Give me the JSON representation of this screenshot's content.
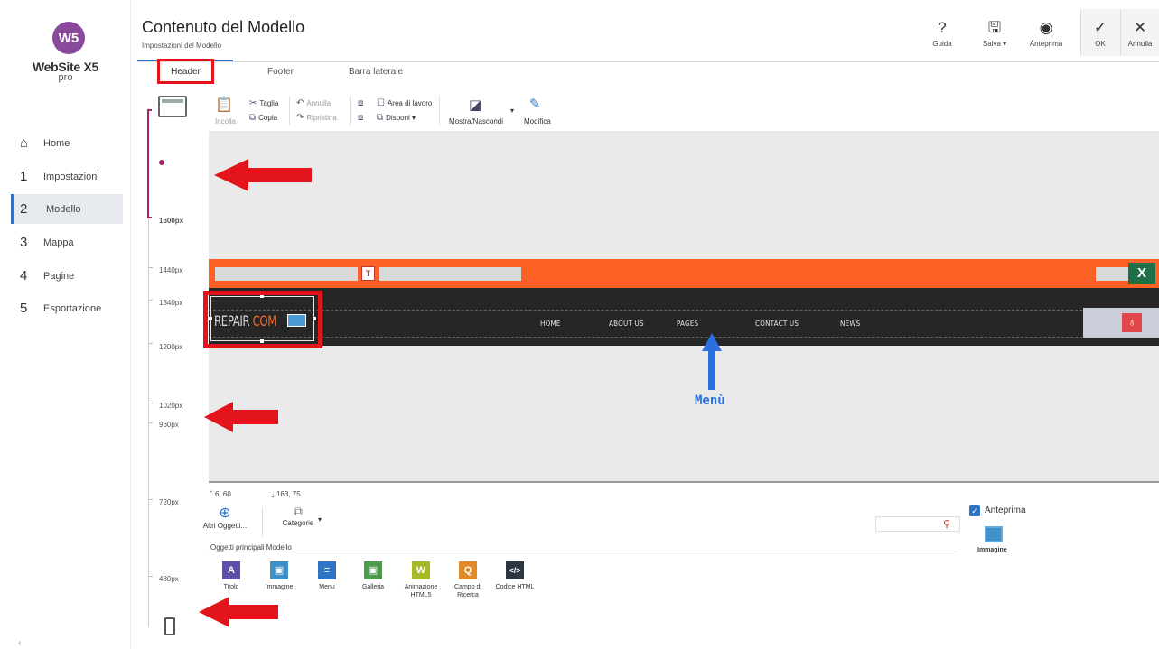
{
  "sidebar": {
    "logo_badge": "W5",
    "logo_name": "WebSite X5",
    "logo_sub": "pro",
    "items": [
      {
        "num": "",
        "label": "Home"
      },
      {
        "num": "1",
        "label": "Impostazioni"
      },
      {
        "num": "2",
        "label": "Modello"
      },
      {
        "num": "3",
        "label": "Mappa"
      },
      {
        "num": "4",
        "label": "Pagine"
      },
      {
        "num": "5",
        "label": "Esportazione"
      }
    ],
    "active_index": 2,
    "collapse": "‹"
  },
  "header": {
    "title": "Contenuto del Modello",
    "subtitle": "Impostazioni del Modello"
  },
  "top_toolbar": {
    "guida": "Guida",
    "salva": "Salva ▾",
    "anteprima": "Anteprima",
    "ok": "OK",
    "annulla": "Annulla"
  },
  "tabs": [
    "Header",
    "Footer",
    "Barra laterale"
  ],
  "ruler": {
    "labels": [
      "1600px",
      "1440px",
      "1340px",
      "1200px",
      "1020px",
      "960px",
      "720px",
      "480px"
    ]
  },
  "edit_toolbar": {
    "incolla": "Incolla",
    "taglia": "Taglia",
    "copia": "Copia",
    "annulla": "Annulla",
    "ripristina": "Ripristina",
    "area_lavoro": "Area di lavoro",
    "disponi": "Disponi ▾",
    "mostra": "Mostra/Nascondi",
    "modifica": "Modifica"
  },
  "canvas": {
    "logo_text": "REPAIR ",
    "logo_accent": "COM",
    "menu": [
      "HOME",
      "ABOUT US",
      "PAGES",
      "CONTACT US",
      "NEWS"
    ],
    "annotation": "Menù"
  },
  "bottom": {
    "pos": "6, 60",
    "size": "163, 75",
    "altri": "Altri Oggetti...",
    "categorie": "Categorie",
    "objs_title": "Oggetti principali Modello",
    "objects": [
      {
        "label": "Titolo",
        "color": "#5b4fa8",
        "glyph": "A"
      },
      {
        "label": "Immagine",
        "color": "#3f8fc9",
        "glyph": "▣"
      },
      {
        "label": "Menu",
        "color": "#2f73c4",
        "glyph": "≡"
      },
      {
        "label": "Galleria",
        "color": "#4e9a4b",
        "glyph": "▣"
      },
      {
        "label": "Animazione HTML5",
        "color": "#a7b927",
        "glyph": "W"
      },
      {
        "label": "Campo di Ricerca",
        "color": "#e08a28",
        "glyph": "Q"
      },
      {
        "label": "Codice HTML",
        "color": "#2c3540",
        "glyph": "</>"
      }
    ],
    "anteprima": "Anteprima",
    "immagine": "Immagine"
  },
  "colors": {
    "accent": "#2f73c4",
    "orange_bar": "#fc6226",
    "dark_bar": "#262626",
    "annotation_red": "#e3141b",
    "annotation_blue": "#2c6fdf"
  }
}
